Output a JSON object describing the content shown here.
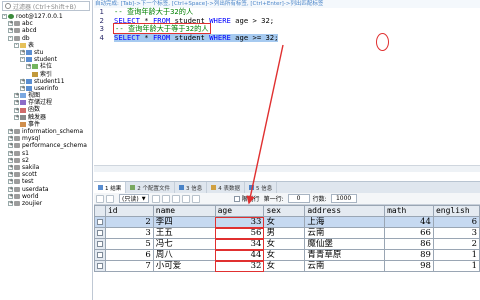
{
  "sidebar": {
    "filter_placeholder": "过滤器 (Ctrl+Shift+B)",
    "items": [
      {
        "label": "root@127.0.0.1",
        "indent": 0,
        "exp": "-",
        "icon": "conn"
      },
      {
        "label": "abc",
        "indent": 1,
        "exp": "+",
        "icon": "db"
      },
      {
        "label": "abcd",
        "indent": 1,
        "exp": "+",
        "icon": "db"
      },
      {
        "label": "db",
        "indent": 1,
        "exp": "-",
        "icon": "db"
      },
      {
        "label": "表",
        "indent": 2,
        "exp": "-",
        "icon": "folder"
      },
      {
        "label": "stu",
        "indent": 3,
        "exp": "+",
        "icon": "table"
      },
      {
        "label": "student",
        "indent": 3,
        "exp": "-",
        "icon": "table"
      },
      {
        "label": "栏位",
        "indent": 4,
        "exp": "+",
        "icon": "col"
      },
      {
        "label": "索引",
        "indent": 4,
        "exp": "",
        "icon": "idx"
      },
      {
        "label": "student11",
        "indent": 3,
        "exp": "+",
        "icon": "table"
      },
      {
        "label": "userinfo",
        "indent": 3,
        "exp": "+",
        "icon": "table"
      },
      {
        "label": "视图",
        "indent": 2,
        "exp": "+",
        "icon": "view"
      },
      {
        "label": "存储过程",
        "indent": 2,
        "exp": "+",
        "icon": "proc"
      },
      {
        "label": "函数",
        "indent": 2,
        "exp": "+",
        "icon": "func"
      },
      {
        "label": "触发器",
        "indent": 2,
        "exp": "+",
        "icon": "trig"
      },
      {
        "label": "事件",
        "indent": 2,
        "exp": "",
        "icon": "evt"
      },
      {
        "label": "information_schema",
        "indent": 1,
        "exp": "+",
        "icon": "db"
      },
      {
        "label": "mysql",
        "indent": 1,
        "exp": "+",
        "icon": "db"
      },
      {
        "label": "performance_schema",
        "indent": 1,
        "exp": "+",
        "icon": "db"
      },
      {
        "label": "s1",
        "indent": 1,
        "exp": "+",
        "icon": "db"
      },
      {
        "label": "s2",
        "indent": 1,
        "exp": "+",
        "icon": "db"
      },
      {
        "label": "sakila",
        "indent": 1,
        "exp": "+",
        "icon": "db"
      },
      {
        "label": "scott",
        "indent": 1,
        "exp": "+",
        "icon": "db"
      },
      {
        "label": "test",
        "indent": 1,
        "exp": "+",
        "icon": "db"
      },
      {
        "label": "userdata",
        "indent": 1,
        "exp": "+",
        "icon": "db"
      },
      {
        "label": "world",
        "indent": 1,
        "exp": "+",
        "icon": "db"
      },
      {
        "label": "zoujier",
        "indent": 1,
        "exp": "+",
        "icon": "db"
      }
    ]
  },
  "editor": {
    "hint": "自动完成: [Tab]->下一个标签, [Ctrl+Space]->列出所有标签, [Ctrl+Enter]->列出匹配标签",
    "line_numbers": [
      "1",
      "2",
      "3",
      "4"
    ],
    "line1_comment": "-- 查询年龄大于32的人",
    "line2": {
      "select": "SELECT",
      "star": " * ",
      "from": "FROM",
      "table": " student ",
      "where": "WHERE",
      "cond": " age > 32;"
    },
    "line3_comment": "-- 查询年龄大于等于32的人",
    "line4": {
      "select": "SELECT",
      "star": " * ",
      "from": "FROM",
      "table": " student ",
      "where": "WHERE",
      "cond": " age >= 32;"
    }
  },
  "result_tabs": [
    {
      "label": "1 结果",
      "active": true
    },
    {
      "label": "2 个配置文件",
      "active": false
    },
    {
      "label": "3 信息",
      "active": false
    },
    {
      "label": "4 表数据",
      "active": false
    },
    {
      "label": "5 信息",
      "active": false
    }
  ],
  "result_toolbar": {
    "readonly_select": "(只读)",
    "limit_label": "限制行",
    "first_row_label": "第一行:",
    "first_row_value": "0",
    "rows_label": "行数:",
    "rows_value": "1000"
  },
  "grid": {
    "columns": [
      "id",
      "name",
      "age",
      "sex",
      "address",
      "math",
      "english"
    ],
    "rows": [
      {
        "id": "2",
        "name": "李四",
        "age": "33",
        "sex": "女",
        "address": "上海",
        "math": "44",
        "english": "6"
      },
      {
        "id": "3",
        "name": "王五",
        "age": "56",
        "sex": "男",
        "address": "云南",
        "math": "66",
        "english": "3"
      },
      {
        "id": "5",
        "name": "冯七",
        "age": "34",
        "sex": "女",
        "address": "魔仙堡",
        "math": "86",
        "english": "2"
      },
      {
        "id": "6",
        "name": "周八",
        "age": "44",
        "sex": "女",
        "address": "青青草原",
        "math": "89",
        "english": "1"
      },
      {
        "id": "7",
        "name": "小可爱",
        "age": "32",
        "sex": "女",
        "address": "云南",
        "math": "98",
        "english": "1"
      }
    ]
  },
  "colors": {
    "annotation": "#e03030",
    "keyword": "#0000ff",
    "comment": "#008000",
    "selection": "#a6caf0"
  }
}
